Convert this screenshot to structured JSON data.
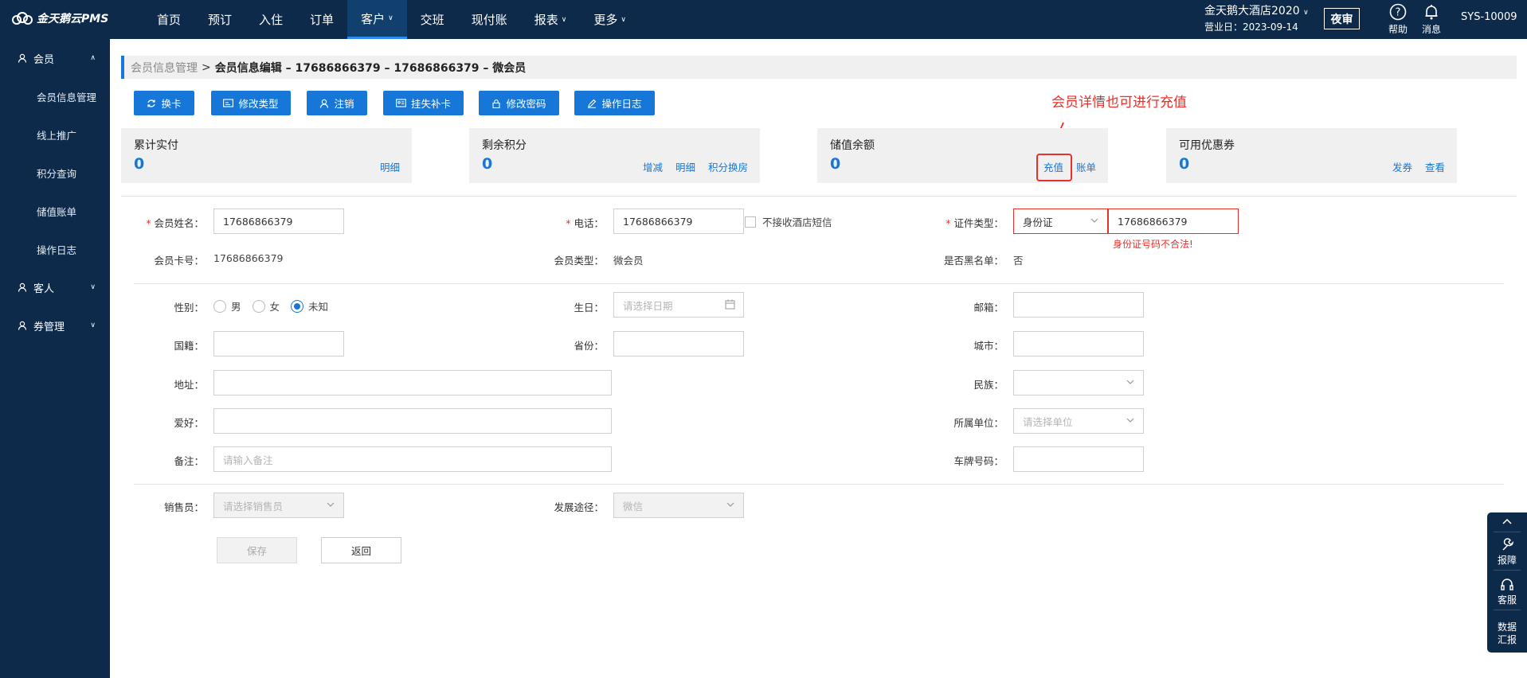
{
  "header": {
    "logo": "金天鹅云PMS",
    "nav": [
      {
        "label": "首页",
        "dropdown": false
      },
      {
        "label": "预订",
        "dropdown": false
      },
      {
        "label": "入住",
        "dropdown": false
      },
      {
        "label": "订单",
        "dropdown": false
      },
      {
        "label": "客户",
        "dropdown": true,
        "active": true
      },
      {
        "label": "交班",
        "dropdown": false
      },
      {
        "label": "现付账",
        "dropdown": false
      },
      {
        "label": "报表",
        "dropdown": true
      },
      {
        "label": "更多",
        "dropdown": true
      }
    ],
    "hotel_name": "金天鹅大酒店2020",
    "business_date": "营业日：2023-09-14",
    "night_audit": "夜审",
    "help": "帮助",
    "messages": "消息",
    "user": "SYS-10009"
  },
  "sidebar": {
    "groups": [
      {
        "label": "会员",
        "expanded": true,
        "items": [
          "会员信息管理",
          "线上推广",
          "积分查询",
          "储值账单",
          "操作日志"
        ]
      },
      {
        "label": "客人",
        "expanded": false
      },
      {
        "label": "券管理",
        "expanded": false
      }
    ]
  },
  "breadcrumb": {
    "parent": "会员信息管理",
    "separator": ">",
    "current": "会员信息编辑 – 17686866379 – 17686866379 – 微会员"
  },
  "actions": [
    "换卡",
    "修改类型",
    "注销",
    "挂失补卡",
    "修改密码",
    "操作日志"
  ],
  "annotation": "会员详情也可进行充值",
  "stats": [
    {
      "label": "累计实付",
      "value": "0",
      "links": [
        "明细"
      ]
    },
    {
      "label": "剩余积分",
      "value": "0",
      "links": [
        "增减",
        "明细",
        "积分换房"
      ]
    },
    {
      "label": "储值余额",
      "value": "0",
      "links": [
        "充值",
        "账单"
      ]
    },
    {
      "label": "可用优惠券",
      "value": "0",
      "links": [
        "发券",
        "查看"
      ]
    }
  ],
  "form": {
    "name": {
      "label": "会员姓名：",
      "value": "17686866379"
    },
    "phone": {
      "label": "电话：",
      "value": "17686866379"
    },
    "no_sms": "不接收酒店短信",
    "id_type": {
      "label": "证件类型：",
      "value": "身份证"
    },
    "id_number": {
      "value": "17686866379",
      "error": "身份证号码不合法!"
    },
    "card_no": {
      "label": "会员卡号：",
      "value": "17686866379"
    },
    "member_type": {
      "label": "会员类型：",
      "value": "微会员"
    },
    "blacklist": {
      "label": "是否黑名单：",
      "value": "否"
    },
    "gender": {
      "label": "性别：",
      "options": [
        "男",
        "女",
        "未知"
      ],
      "selected": "未知"
    },
    "birthday": {
      "label": "生日：",
      "placeholder": "请选择日期"
    },
    "email": {
      "label": "邮箱：",
      "value": ""
    },
    "nationality": {
      "label": "国籍：",
      "value": ""
    },
    "province": {
      "label": "省份：",
      "value": ""
    },
    "city": {
      "label": "城市：",
      "value": ""
    },
    "address": {
      "label": "地址：",
      "value": ""
    },
    "ethnicity": {
      "label": "民族：",
      "value": ""
    },
    "hobby": {
      "label": "爱好：",
      "value": ""
    },
    "company": {
      "label": "所属单位：",
      "placeholder": "请选择单位"
    },
    "remark": {
      "label": "备注：",
      "placeholder": "请输入备注"
    },
    "plate": {
      "label": "车牌号码：",
      "value": ""
    },
    "salesperson": {
      "label": "销售员：",
      "placeholder": "请选择销售员"
    },
    "channel": {
      "label": "发展途径：",
      "value": "微信"
    }
  },
  "buttons": {
    "save": "保存",
    "back": "返回"
  },
  "float_bar": {
    "report": "报障",
    "service": "客服",
    "data_line1": "数据",
    "data_line2": "汇报"
  }
}
